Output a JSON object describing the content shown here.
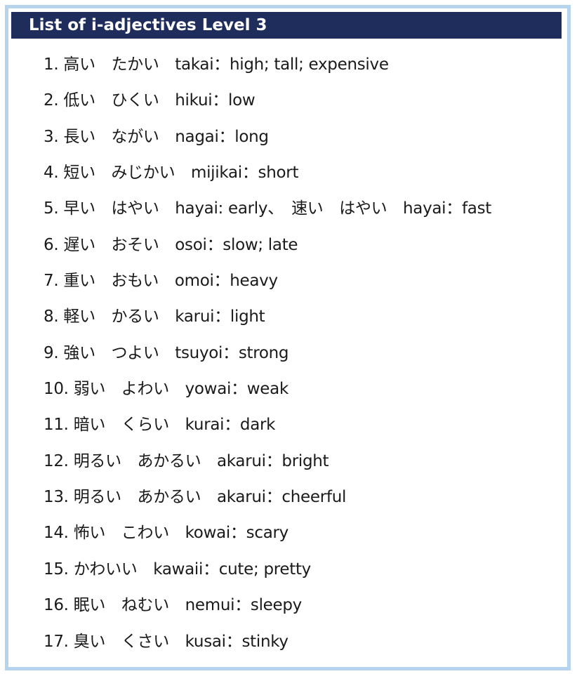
{
  "header": {
    "title": "List of i-adjectives Level 3"
  },
  "items": [
    {
      "number": "1.",
      "text": "高い　たかい　takai：high; tall; expensive"
    },
    {
      "number": "2.",
      "text": "低い　ひくい　hikui：low"
    },
    {
      "number": "3.",
      "text": "長い　ながい　nagai：long"
    },
    {
      "number": "4.",
      "text": "短い　みじかい　mijikai：short"
    },
    {
      "number": "5.",
      "text": "早い　はやい　hayai: early、　速い　はやい　hayai：fast"
    },
    {
      "number": "6.",
      "text": "遅い　おそい　osoi：slow; late"
    },
    {
      "number": "7.",
      "text": "重い　おもい　omoi：heavy"
    },
    {
      "number": "8.",
      "text": "軽い　かるい　karui：light"
    },
    {
      "number": "9.",
      "text": "強い　つよい　tsuyoi：strong"
    },
    {
      "number": "10.",
      "text": "弱い　よわい　yowai：weak"
    },
    {
      "number": "11.",
      "text": "暗い　くらい　kurai：dark"
    },
    {
      "number": "12.",
      "text": "明るい　あかるい　akarui：bright"
    },
    {
      "number": "13.",
      "text": "明るい　あかるい　akarui：cheerful"
    },
    {
      "number": "14.",
      "text": "怖い　こわい　kowai：scary"
    },
    {
      "number": "15.",
      "text": "かわいい　kawaii：cute; pretty"
    },
    {
      "number": "16.",
      "text": "眠い　ねむい　nemui：sleepy"
    },
    {
      "number": "17.",
      "text": "臭い　くさい　kusai：stinky"
    }
  ]
}
